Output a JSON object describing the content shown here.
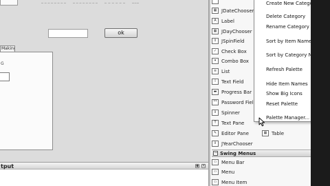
{
  "designer": {
    "ok_button": "ok",
    "tab_label": "Making",
    "inner_fragment": "G"
  },
  "output": {
    "title": "tput",
    "ctrl_restore": "◆",
    "ctrl_close": "×"
  },
  "palette": {
    "items": [
      {
        "label": "JDateChooser",
        "icon": "jdatechooser-icon",
        "glyph": "▦"
      },
      {
        "label": "Label",
        "icon": "label-icon",
        "glyph": "A"
      },
      {
        "label": "JDayChooser",
        "icon": "jdaychooser-icon",
        "glyph": "▦"
      },
      {
        "label": "JSpinField",
        "icon": "jspinfield-icon",
        "glyph": "⇕"
      },
      {
        "label": "Check Box",
        "icon": "checkbox-icon",
        "glyph": "✓"
      },
      {
        "label": "Combo Box",
        "icon": "combobox-icon",
        "glyph": "▾"
      },
      {
        "label": "List",
        "icon": "list-icon",
        "glyph": "≡"
      },
      {
        "label": "Text Field",
        "icon": "textfield-icon",
        "glyph": "I"
      },
      {
        "label": "Progress Bar",
        "icon": "progressbar-icon",
        "glyph": "▬"
      },
      {
        "label": "Password Field",
        "icon": "passwordfield-icon",
        "glyph": "**"
      },
      {
        "label": "Spinner",
        "icon": "spinner-icon",
        "glyph": "⇕"
      },
      {
        "label": "Text Pane",
        "icon": "textpane-icon",
        "glyph": "T"
      },
      {
        "label": "Editor Pane",
        "icon": "editorpane-icon",
        "glyph": "✎"
      },
      {
        "label": "JYearChooser",
        "icon": "jyearchooser-icon",
        "glyph": "⇕"
      }
    ],
    "col2_item": {
      "label": "Table",
      "icon": "table-icon",
      "glyph": "▦"
    },
    "category": {
      "label": "Swing Menus",
      "toggle": "−"
    },
    "menu_items": [
      {
        "label": "Menu Bar",
        "icon": "menubar-icon",
        "glyph": "▭"
      },
      {
        "label": "Menu",
        "icon": "menu-icon",
        "glyph": "▭"
      },
      {
        "label": "Menu Item",
        "icon": "menuitem-icon",
        "glyph": "▭"
      }
    ]
  },
  "context_menu": {
    "items": [
      "Create New Category",
      "Delete Category",
      "Rename Category",
      "Sort by Item Name",
      "Sort by Category Name",
      "Refresh Palette",
      "Hide Item Names",
      "Show Big Icons",
      "Reset Palette",
      "Palette Manager..."
    ]
  }
}
